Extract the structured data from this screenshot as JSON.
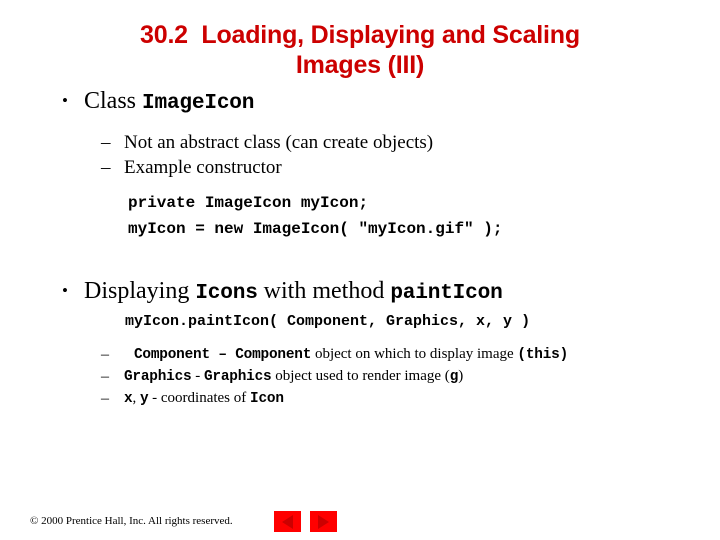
{
  "slide": {
    "title_line1": "30.2  Loading, Displaying and Scaling",
    "title_line2": "Images (III)",
    "title_color": "#cc0000"
  },
  "bullet1": {
    "marker": "•",
    "text_before": "Class ",
    "code": "ImageIcon"
  },
  "sub1": {
    "marker": "–",
    "text": "Not an abstract class (can create objects)"
  },
  "sub2": {
    "marker": "–",
    "text": "Example constructor"
  },
  "code_block": {
    "line1": "private ImageIcon myIcon;",
    "line2": "myIcon = new ImageIcon( \"myIcon.gif\" );"
  },
  "bullet2": {
    "marker": "•",
    "text_before": "Displaying ",
    "code1": "Icons",
    "text_middle": " with method  ",
    "code2": "paintIcon"
  },
  "signature": {
    "text": "myIcon.paintIcon( Component, Graphics, x, y )"
  },
  "params": [
    {
      "marker": "–",
      "code1": "Component",
      "sep": " – ",
      "code2": "Component",
      "text": " object on which to display image ",
      "code3": "(this)"
    },
    {
      "marker": "–",
      "code1": "Graphics",
      "sep": " - ",
      "code2": "Graphics",
      "text": " object used to render image (",
      "code3": "g",
      "text_after": ")"
    },
    {
      "marker": "–",
      "code1": "x",
      "sep": ", ",
      "code2": "y",
      "text": " - coordinates of ",
      "code3": "Icon"
    }
  ],
  "footer": {
    "copyright": "© 2000 Prentice Hall, Inc.  All rights reserved."
  },
  "nav": {
    "prev_label": "Previous slide",
    "next_label": "Next slide",
    "button_color": "#ff0000",
    "arrow_color": "#cc0000"
  }
}
